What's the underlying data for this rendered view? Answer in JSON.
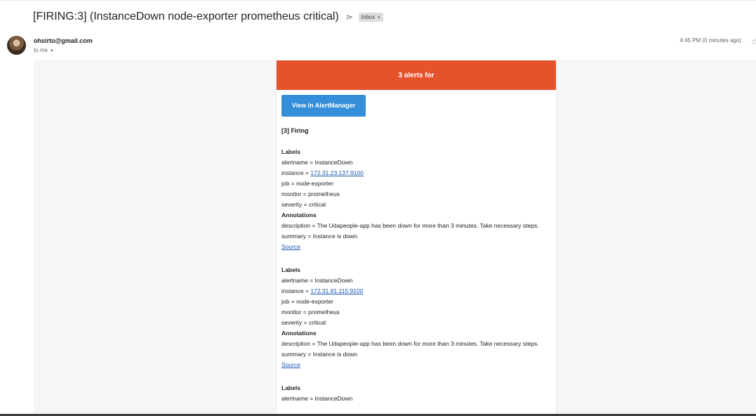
{
  "subject": {
    "title": "[FIRING:3] (InstanceDown node-exporter prometheus critical)",
    "label_chip": "Inbox",
    "chip_close": "×",
    "important_icon": "label-arrow-icon"
  },
  "message": {
    "sender": "ohsirto@gmail.com",
    "to": "to me",
    "time": "4:45 PM (0 minutes ago)"
  },
  "email": {
    "banner": "3 alerts for",
    "button_label": "View In AlertManager",
    "firing": "[3] Firing",
    "labels_heading": "Labels",
    "annotations_heading": "Annotations",
    "source_label": "Source",
    "alerts": [
      {
        "alertname": "alertname = InstanceDown",
        "instance_prefix": "instance = ",
        "instance": "172.31.23.137:9100",
        "job": "job = node-exporter",
        "monitor": "monitor = prometheus",
        "severity": "severity = critical",
        "description": "description = The Udapeople-app has been down for more than 3 minutes. Take necessary steps.",
        "summary": "summary = Instance is down"
      },
      {
        "alertname": "alertname = InstanceDown",
        "instance_prefix": "instance = ",
        "instance": "172.31.81.115:9100",
        "job": "job = node-exporter",
        "monitor": "monitor = prometheus",
        "severity": "severity = critical",
        "description": "description = The Udapeople-app has been down for more than 3 minutes. Take necessary steps.",
        "summary": "summary = Instance is down"
      },
      {
        "alertname": "alertname = InstanceDown"
      }
    ]
  },
  "colors": {
    "banner": "#e6522c",
    "button": "#348eda",
    "link": "#1a55b0"
  }
}
